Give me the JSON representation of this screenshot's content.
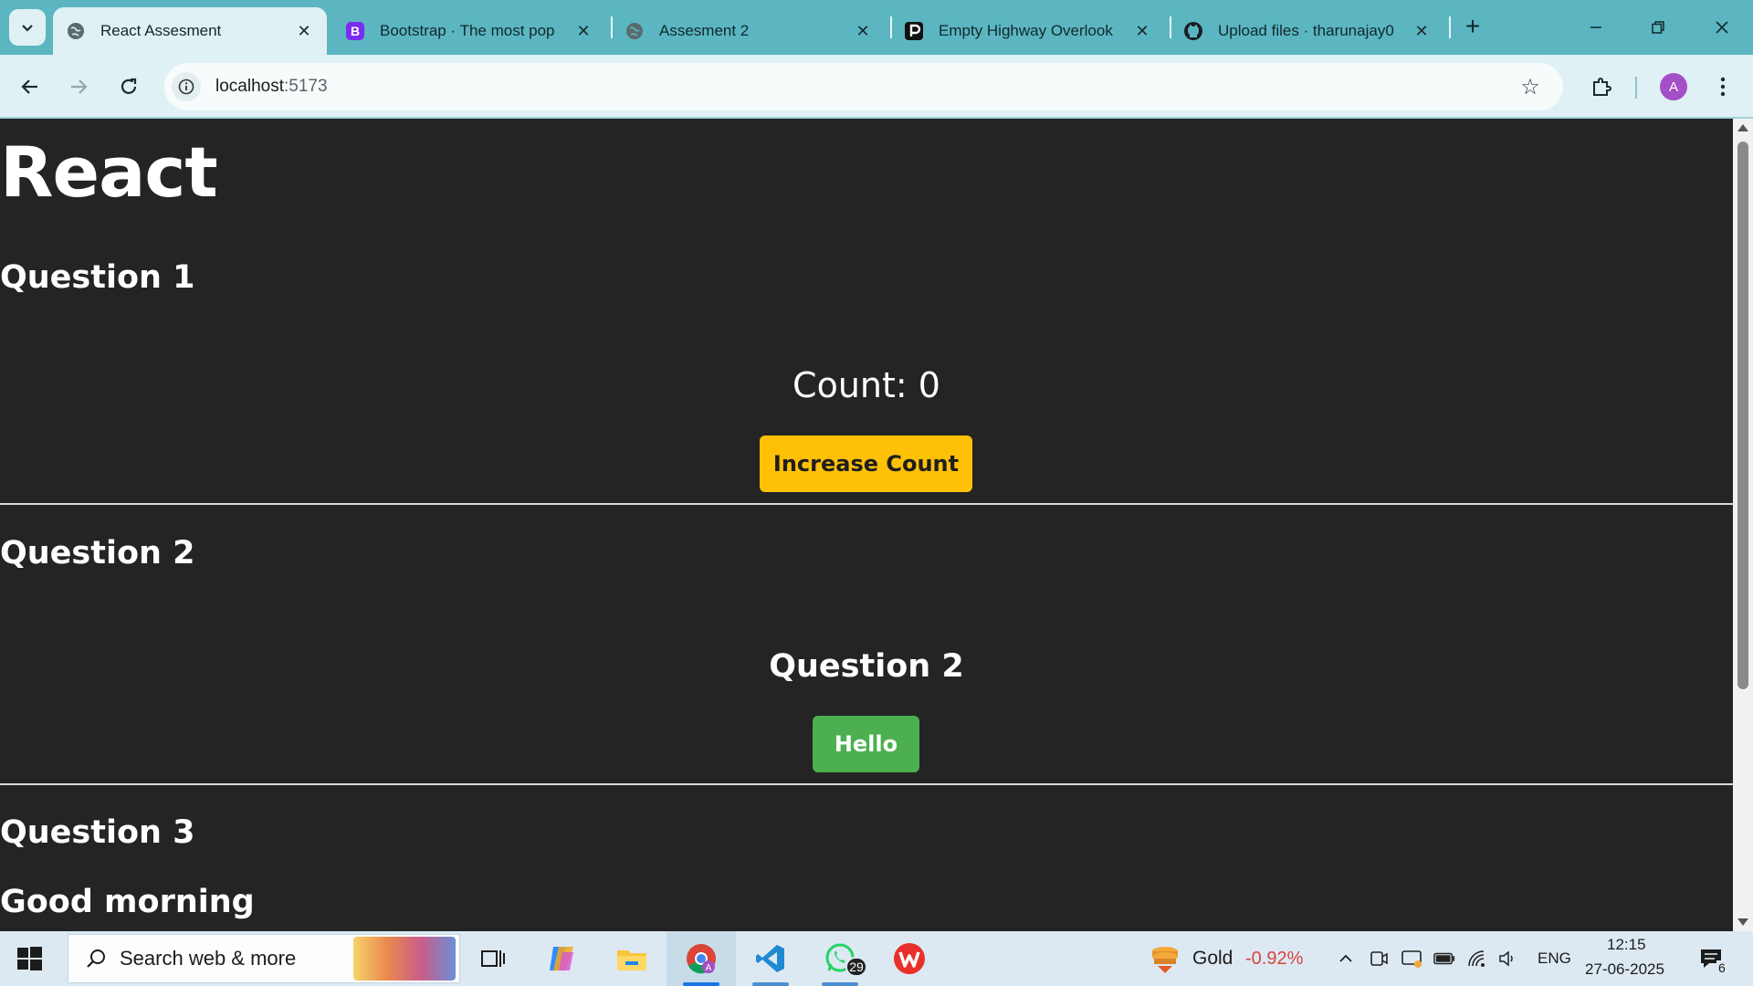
{
  "browser": {
    "tabs": [
      {
        "title": "React Assesment",
        "icon": "globe-icon",
        "active": true
      },
      {
        "title": "Bootstrap · The most pop",
        "icon": "bootstrap-icon",
        "active": false
      },
      {
        "title": "Assesment 2",
        "icon": "globe-icon",
        "active": false
      },
      {
        "title": "Empty Highway Overlook",
        "icon": "pexels-icon",
        "active": false
      },
      {
        "title": "Upload files · tharunajay0",
        "icon": "github-icon",
        "active": false
      }
    ],
    "url_host": "localhost",
    "url_port": ":5173",
    "profile_initial": "A",
    "colors": {
      "tabstrip": "#5bb6c2",
      "toolbar": "#dff1f4",
      "profile": "#a44fc6"
    }
  },
  "page": {
    "title": "React",
    "q1": {
      "heading": "Question 1",
      "count_text": "Count: 0",
      "button": "Increase Count"
    },
    "q2": {
      "heading": "Question 2",
      "inner_heading": "Question 2",
      "button": "Hello"
    },
    "q3": {
      "heading": "Question 3",
      "greeting": "Good morning"
    },
    "colors": {
      "background": "#242424",
      "yellow_button": "#ffc107",
      "green_button": "#4caf50"
    }
  },
  "taskbar": {
    "search_placeholder": "Search web & more",
    "whatsapp_badge": "29",
    "widget_label": "Gold",
    "widget_change": "-0.92%",
    "language": "ENG",
    "time": "12:15",
    "date": "27-06-2025",
    "notifications": "6"
  }
}
